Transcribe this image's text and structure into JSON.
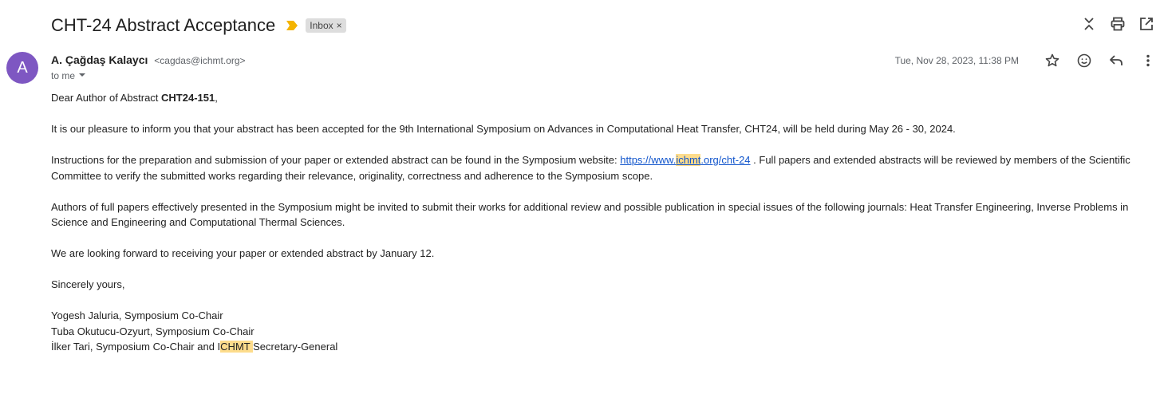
{
  "email": {
    "subject": "CHT-24 Abstract Acceptance",
    "label": "Inbox",
    "label_remove": "×",
    "avatar_letter": "A",
    "sender_name": "A. Çağdaş Kalaycı",
    "sender_email": "<cagdas@ichmt.org>",
    "to": "to me",
    "date": "Tue, Nov 28, 2023, 11:38 PM"
  },
  "body": {
    "greeting_pre": "Dear Author of Abstract ",
    "abstract_id": "CHT24-151",
    "greeting_post": ",",
    "p1": "It is our pleasure to inform you that your abstract has been accepted for the 9th International Symposium on Advances in Computational Heat Transfer, CHT24, will be held during May 26 - 30, 2024.",
    "p2_pre": "Instructions for the preparation and submission of your paper or extended abstract can be found in the Symposium website: ",
    "link_a": "https://www.",
    "link_hl": "ichmt",
    "link_b": ".org/cht-24",
    "p2_post": " . Full papers and extended abstracts will be reviewed by members of the Scientific Committee to verify the submitted works regarding their relevance, originality, correctness and adherence to the Symposium scope.",
    "p3": "Authors of full papers effectively presented in the Symposium might be invited to submit their works for additional review and possible publication in special issues of the following journals:  Heat Transfer Engineering, Inverse Problems in Science and Engineering and Computational Thermal Sciences.",
    "p4": "We are looking forward to receiving your paper or extended abstract by January 12.",
    "closing": "Sincerely yours,",
    "sig1": "Yogesh Jaluria, Symposium Co-Chair",
    "sig2": "Tuba Okutucu-Ozyurt, Symposium Co-Chair",
    "sig3_pre": "İlker Tari, Symposium Co-Chair and I",
    "sig3_hl": "CHMT ",
    "sig3_post": "Secretary-General"
  },
  "colors": {
    "avatar": "#7e57c2",
    "important": "#f4b400",
    "link": "#1155cc",
    "highlight": "#fddc8c"
  },
  "icons": [
    "important-marker-icon",
    "collapse-all-icon",
    "print-icon",
    "open-new-window-icon",
    "star-icon",
    "emoji-icon",
    "reply-icon",
    "more-vert-icon",
    "chevron-down-icon"
  ]
}
